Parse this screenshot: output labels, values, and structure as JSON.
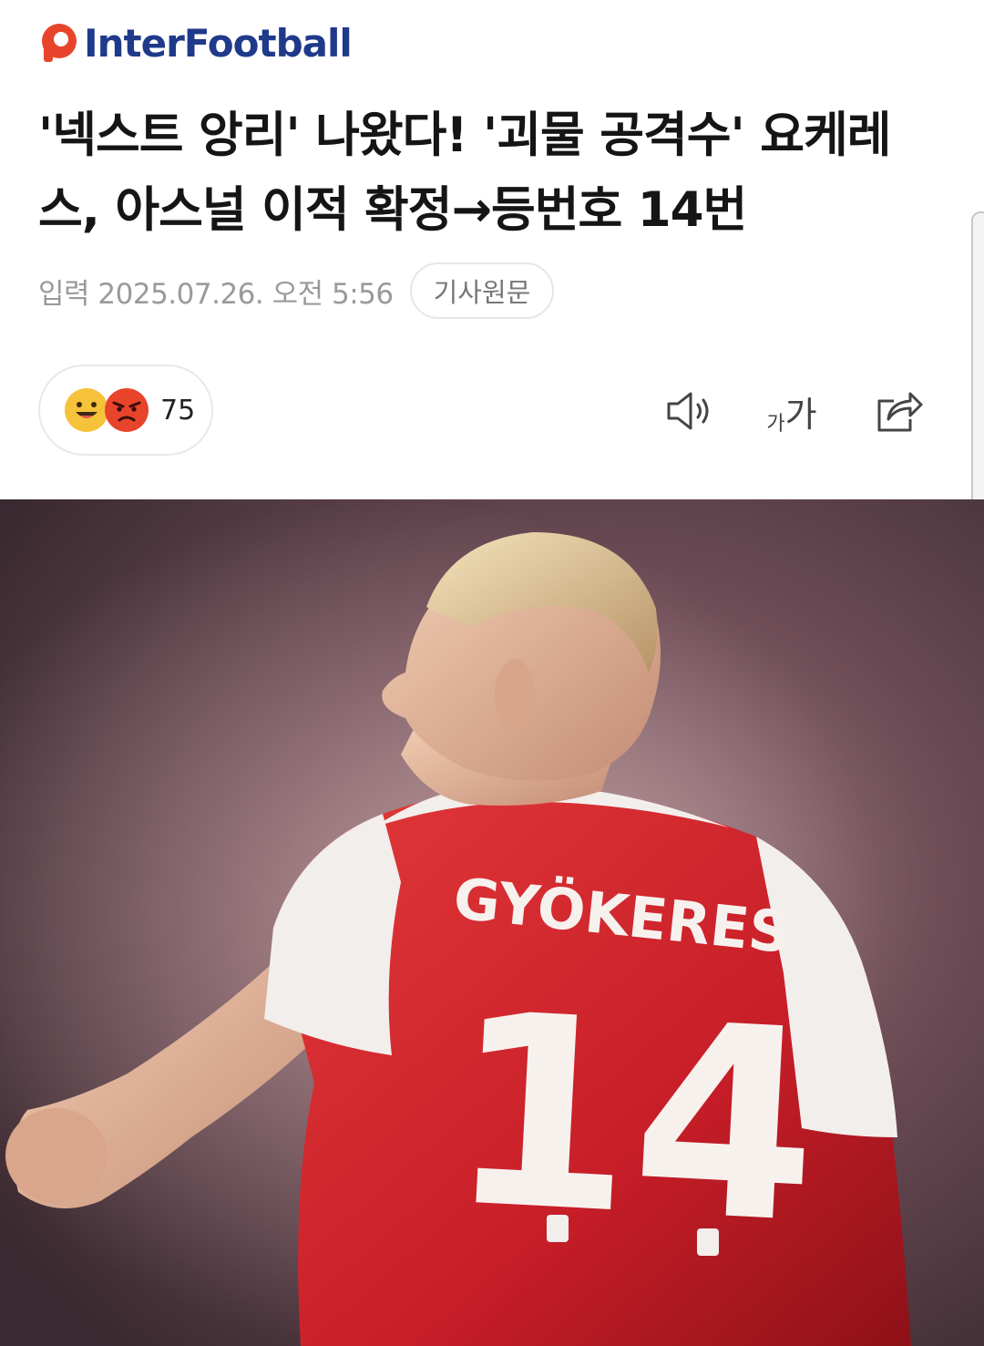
{
  "brand": {
    "name": "InterFootball"
  },
  "article": {
    "headline": "'넥스트 앙리' 나왔다! '괴물 공격수' 요케레스, 아스널 이적 확정→등번호 14번",
    "published": "입력 2025.07.26. 오전 5:56",
    "original_button": "기사원문"
  },
  "reactions": {
    "count": "75",
    "emojis": [
      "smile-emoji-icon",
      "angry-emoji-icon"
    ]
  },
  "toolbar": {
    "font_small": "가",
    "font_large": "가",
    "icons": [
      "speaker-icon",
      "font-size-icon",
      "share-icon"
    ]
  },
  "hero": {
    "jersey_name": "GYÖKERES",
    "jersey_number": "14"
  },
  "colors": {
    "brand_red": "#e8442c",
    "brand_blue": "#1f3a8a",
    "jersey_red": "#d8202a"
  }
}
